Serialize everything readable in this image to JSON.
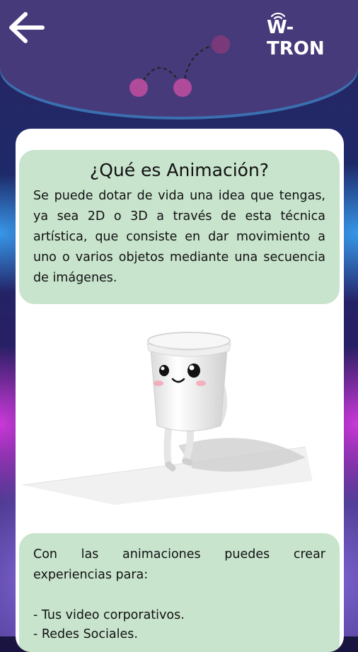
{
  "header": {
    "back_label": "Back",
    "logo_text": "W-TRON"
  },
  "section1": {
    "title": "¿Qué es Animación?",
    "body": "Se puede dotar de vida una idea que tengas, ya sea 2D o 3D a través de esta técnica artística, que consiste en dar movimiento a uno o varios objetos mediante una secuencia de imágenes."
  },
  "section2": {
    "intro": "Con las animaciones puedes crear experiencias para:",
    "items": [
      "- Tus video corporativos.",
      "- Redes Sociales."
    ]
  },
  "colors": {
    "header": "#463a7a",
    "box": "#c8e4cd",
    "dot": "#b04a9a"
  },
  "icons": {
    "back": "arrow-left-icon",
    "logo": "wifi-icon",
    "character": "cup-character-illustration"
  }
}
